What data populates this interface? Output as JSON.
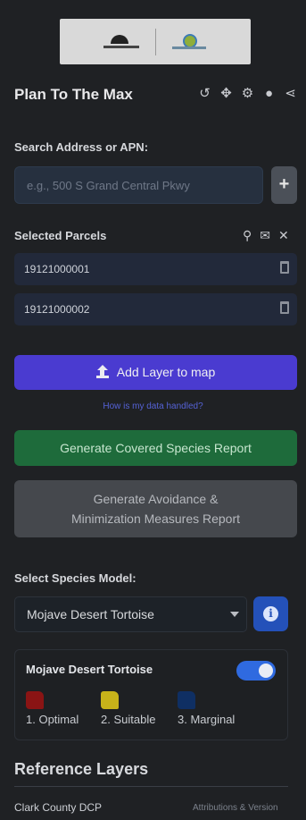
{
  "header": {
    "app_title": "Plan To The Max",
    "icons": [
      "undo-icon",
      "move-icon",
      "settings-icon",
      "help-icon",
      "share-icon"
    ]
  },
  "search": {
    "label": "Search Address or APN:",
    "placeholder": "e.g., 500 S Grand Central Pkwy",
    "value": "",
    "add_icon": "+"
  },
  "parcels": {
    "label": "Selected Parcels",
    "icons": [
      "search-icon",
      "mail-icon",
      "close-icon"
    ],
    "items": [
      "19121000001",
      "19121000002"
    ]
  },
  "actions": {
    "add_layer_label": "Add Layer to map",
    "help_link": "How is my data handled?",
    "covered_species_label": "Generate Covered Species Report",
    "avoidance_line1": "Generate Avoidance &",
    "avoidance_line2": "Minimization Measures Report"
  },
  "species": {
    "label": "Select Species Model:",
    "selected": "Mojave Desert Tortoise",
    "info_glyph": "i",
    "card_title": "Mojave Desert Tortoise",
    "toggle_on": true,
    "legend": [
      {
        "label": "1. Optimal",
        "color": "#8a1414"
      },
      {
        "label": "2. Suitable",
        "color": "#c7b21a"
      },
      {
        "label": "3. Marginal",
        "color": "#0f2f63"
      }
    ]
  },
  "reference": {
    "title": "Reference Layers",
    "footer_left": "Clark County DCP",
    "footer_right": "Attributions & Version"
  },
  "colors": {
    "accent_purple": "#4a3bd0",
    "accent_green": "#1e6b3b",
    "accent_blue": "#2451b9"
  }
}
